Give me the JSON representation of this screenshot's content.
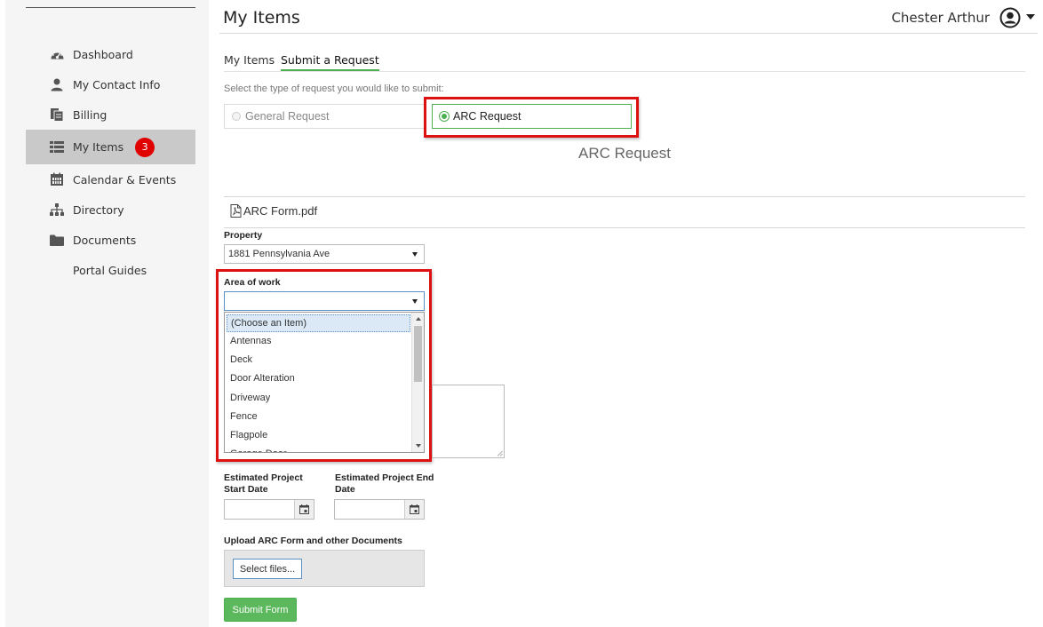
{
  "sidebar": {
    "items": [
      {
        "label": "Dashboard",
        "icon": "dashboard-gauge-icon"
      },
      {
        "label": "My Contact Info",
        "icon": "user-icon"
      },
      {
        "label": "Billing",
        "icon": "billing-documents-icon"
      },
      {
        "label": "My Items",
        "icon": "list-icon",
        "badge": "3",
        "active": true
      },
      {
        "label": "Calendar & Events",
        "icon": "calendar-icon"
      },
      {
        "label": "Directory",
        "icon": "org-chart-icon"
      },
      {
        "label": "Documents",
        "icon": "folder-icon"
      },
      {
        "label": "Portal Guides"
      }
    ]
  },
  "header": {
    "title": "My Items",
    "user_name": "Chester Arthur"
  },
  "tabs": [
    {
      "label": "My Items"
    },
    {
      "label": "Submit a Request",
      "active": true
    }
  ],
  "request": {
    "hint": "Select the type of request you would like to submit:",
    "options": [
      {
        "label": "General Request",
        "selected": false
      },
      {
        "label": "ARC Request",
        "selected": true
      }
    ],
    "form_title": "ARC Request",
    "pdf_link": "ARC Form.pdf"
  },
  "form": {
    "property_label": "Property",
    "property_value": "1881 Pennsylvania Ave",
    "area_label": "Area of work",
    "area_options": [
      "(Choose an Item)",
      "Antennas",
      "Deck",
      "Door Alteration",
      "Driveway",
      "Fence",
      "Flagpole",
      "Garage Door"
    ],
    "start_date_label_1": "Estimated Project",
    "start_date_label_2": "Start Date",
    "end_date_label_1": "Estimated Project End",
    "end_date_label_2": "Date",
    "upload_label": "Upload ARC Form and other Documents",
    "select_files": "Select files...",
    "submit": "Submit Form"
  },
  "colors": {
    "accent_green": "#4caf50",
    "badge_red": "#e00000",
    "highlight_red": "#dd1111",
    "sidebar_bg": "#f5f5f5",
    "active_nav_bg": "#c9c9c9"
  }
}
